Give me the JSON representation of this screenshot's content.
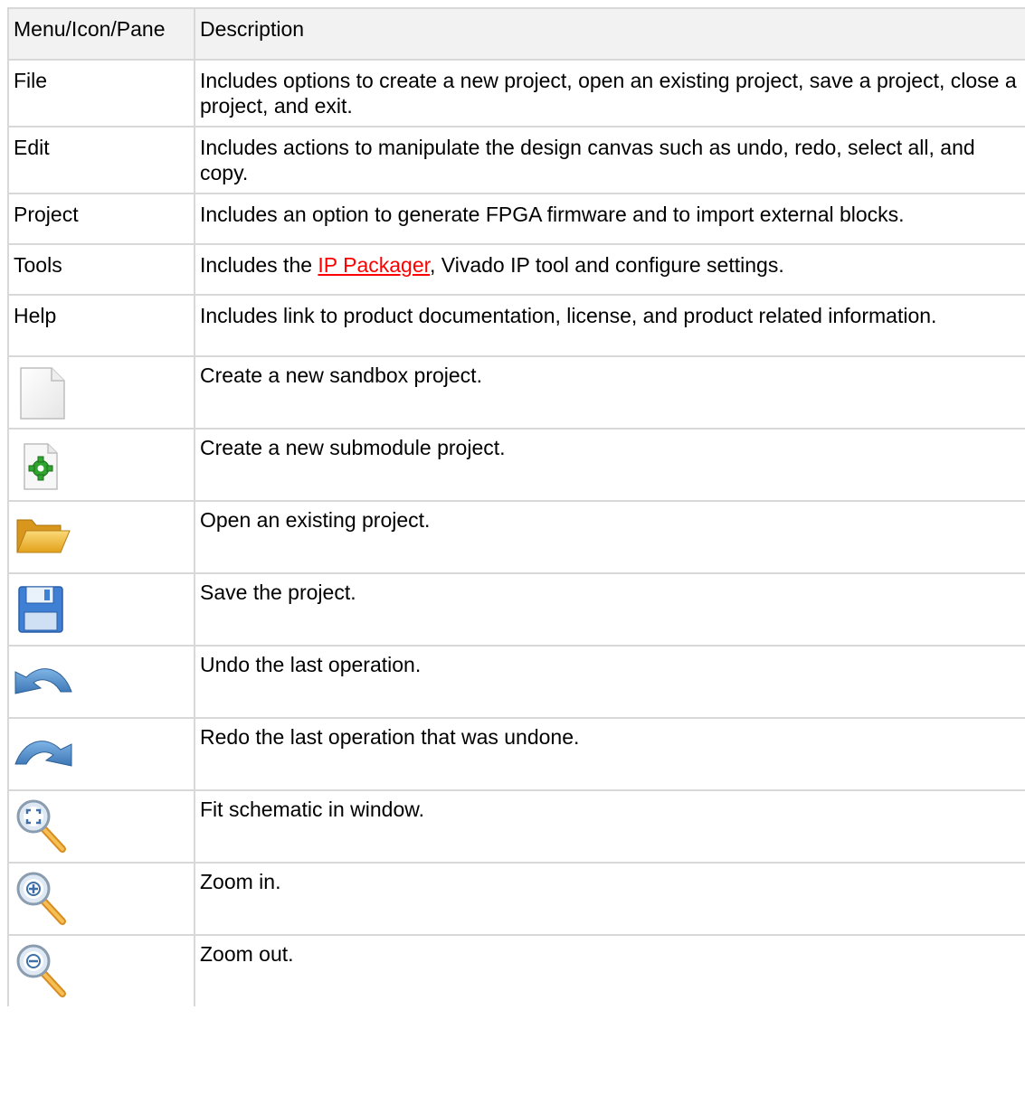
{
  "header": {
    "col1": "Menu/Icon/Pane",
    "col2": "Description"
  },
  "menus": [
    {
      "name": "File",
      "description": "Includes options to create a new project, open an existing project, save a project, close a project, and exit."
    },
    {
      "name": "Edit",
      "description": "Includes actions to manipulate the design canvas such as undo, redo, select all, and copy."
    },
    {
      "name": "Project",
      "description": "Includes an option to generate FPGA firmware and to import external blocks."
    },
    {
      "name": "Tools",
      "description_before": "Includes the ",
      "link": "IP Packager",
      "description_after": ", Vivado IP tool and configure settings."
    },
    {
      "name": "Help",
      "description": "Includes link to product documentation, license, and product related information."
    }
  ],
  "icons": [
    {
      "icon": "new-file-icon",
      "description": "Create a new sandbox project."
    },
    {
      "icon": "new-submodule-icon",
      "description": "Create a new submodule project."
    },
    {
      "icon": "open-folder-icon",
      "description": "Open an existing project."
    },
    {
      "icon": "save-icon",
      "description": "Save the project."
    },
    {
      "icon": "undo-icon",
      "description": "Undo the last operation."
    },
    {
      "icon": "redo-icon",
      "description": "Redo the last operation that was undone."
    },
    {
      "icon": "zoom-fit-icon",
      "description": "Fit schematic in window."
    },
    {
      "icon": "zoom-in-icon",
      "description": "Zoom in."
    },
    {
      "icon": "zoom-out-icon",
      "description": "Zoom out."
    }
  ],
  "colors": {
    "link": "#ff0000",
    "header_bg": "#f2f2f2",
    "border": "#d8d8d8"
  }
}
